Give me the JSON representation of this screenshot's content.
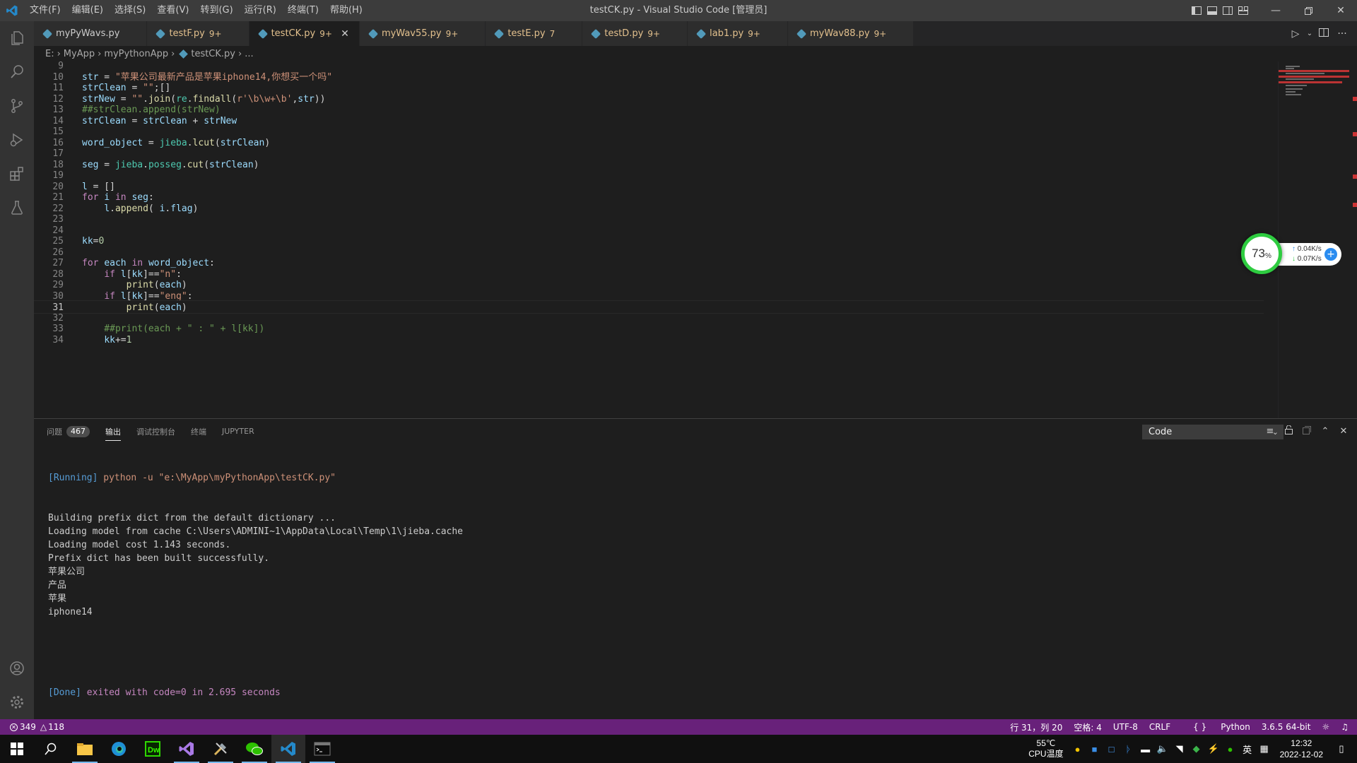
{
  "window": {
    "title": "testCK.py - Visual Studio Code [管理员]",
    "menu": [
      "文件(F)",
      "编辑(E)",
      "选择(S)",
      "查看(V)",
      "转到(G)",
      "运行(R)",
      "终端(T)",
      "帮助(H)"
    ]
  },
  "tabs": [
    {
      "name": "myPyWavs.py",
      "badge": "",
      "plain": true
    },
    {
      "name": "testF.py",
      "badge": "9+"
    },
    {
      "name": "testCK.py",
      "badge": "9+",
      "active": true
    },
    {
      "name": "myWav55.py",
      "badge": "9+"
    },
    {
      "name": "testE.py",
      "badge": "7"
    },
    {
      "name": "testD.py",
      "badge": "9+"
    },
    {
      "name": "lab1.py",
      "badge": "9+"
    },
    {
      "name": "myWav88.py",
      "badge": "9+"
    }
  ],
  "breadcrumb": [
    "E:",
    "MyApp",
    "myPythonApp",
    "testCK.py",
    "..."
  ],
  "editor": {
    "current_line": 31,
    "lines": [
      {
        "n": "9",
        "t": ""
      },
      {
        "n": "10",
        "t": "str = \"苹果公司最新产品是苹果iphone14,你想买一个吗\""
      },
      {
        "n": "11",
        "t": "strClean = \"\";[]"
      },
      {
        "n": "12",
        "t": "strNew = \"\".join(re.findall(r'\\b\\w+\\b',str))"
      },
      {
        "n": "13",
        "t": "##strClean.append(strNew)"
      },
      {
        "n": "14",
        "t": "strClean = strClean + strNew"
      },
      {
        "n": "15",
        "t": ""
      },
      {
        "n": "16",
        "t": "word_object = jieba.lcut(strClean)"
      },
      {
        "n": "17",
        "t": ""
      },
      {
        "n": "18",
        "t": "seg = jieba.posseg.cut(strClean)"
      },
      {
        "n": "19",
        "t": ""
      },
      {
        "n": "20",
        "t": "l = []"
      },
      {
        "n": "21",
        "t": "for i in seg:"
      },
      {
        "n": "22",
        "t": "    l.append( i.flag)"
      },
      {
        "n": "23",
        "t": ""
      },
      {
        "n": "24",
        "t": ""
      },
      {
        "n": "25",
        "t": "kk=0"
      },
      {
        "n": "26",
        "t": ""
      },
      {
        "n": "27",
        "t": "for each in word_object:"
      },
      {
        "n": "28",
        "t": "    if l[kk]==\"n\":"
      },
      {
        "n": "29",
        "t": "        print(each)"
      },
      {
        "n": "30",
        "t": "    if l[kk]==\"eng\":"
      },
      {
        "n": "31",
        "t": "        print(each)"
      },
      {
        "n": "32",
        "t": ""
      },
      {
        "n": "33",
        "t": "    ##print(each + \" : \" + l[kk])"
      },
      {
        "n": "34",
        "t": "    kk+=1"
      }
    ]
  },
  "net_widget": {
    "percent": "73",
    "percent_unit": "%",
    "up": "0.04K/s",
    "down": "0.07K/s"
  },
  "panel": {
    "tabs": [
      {
        "label": "问题",
        "badge": "467"
      },
      {
        "label": "输出",
        "active": true
      },
      {
        "label": "调试控制台"
      },
      {
        "label": "终端"
      },
      {
        "label": "JUPYTER"
      }
    ],
    "output_select": "Code",
    "output": {
      "running_tag": "[Running]",
      "running_cmd": " python -u \"e:\\MyApp\\myPythonApp\\testCK.py\"",
      "lines": [
        "Building prefix dict from the default dictionary ...",
        "Loading model from cache C:\\Users\\ADMINI~1\\AppData\\Local\\Temp\\1\\jieba.cache",
        "Loading model cost 1.143 seconds.",
        "Prefix dict has been built successfully.",
        "苹果公司",
        "产品",
        "苹果",
        "iphone14"
      ],
      "done_tag": "[Done]",
      "done_text": " exited with code=0 in 2.695 seconds"
    }
  },
  "statusbar": {
    "errors": "349",
    "warnings": "118",
    "position": "行 31，列 20",
    "spaces": "空格: 4",
    "encoding": "UTF-8",
    "eol": "CRLF",
    "language": "Python",
    "interpreter": "3.6.5 64-bit"
  },
  "taskbar": {
    "temp": "55℃",
    "cpu_label": "CPU温度",
    "ime": "英",
    "time": "12:32",
    "date": "2022-12-02"
  },
  "colors": {
    "accent": "#68217a",
    "tab_modified": "#e2c08d",
    "keyword": "#c586c0",
    "string": "#ce9178",
    "comment": "#6a9955",
    "function": "#dcdcaa",
    "variable": "#9cdcfe",
    "module": "#4ec9b0"
  }
}
